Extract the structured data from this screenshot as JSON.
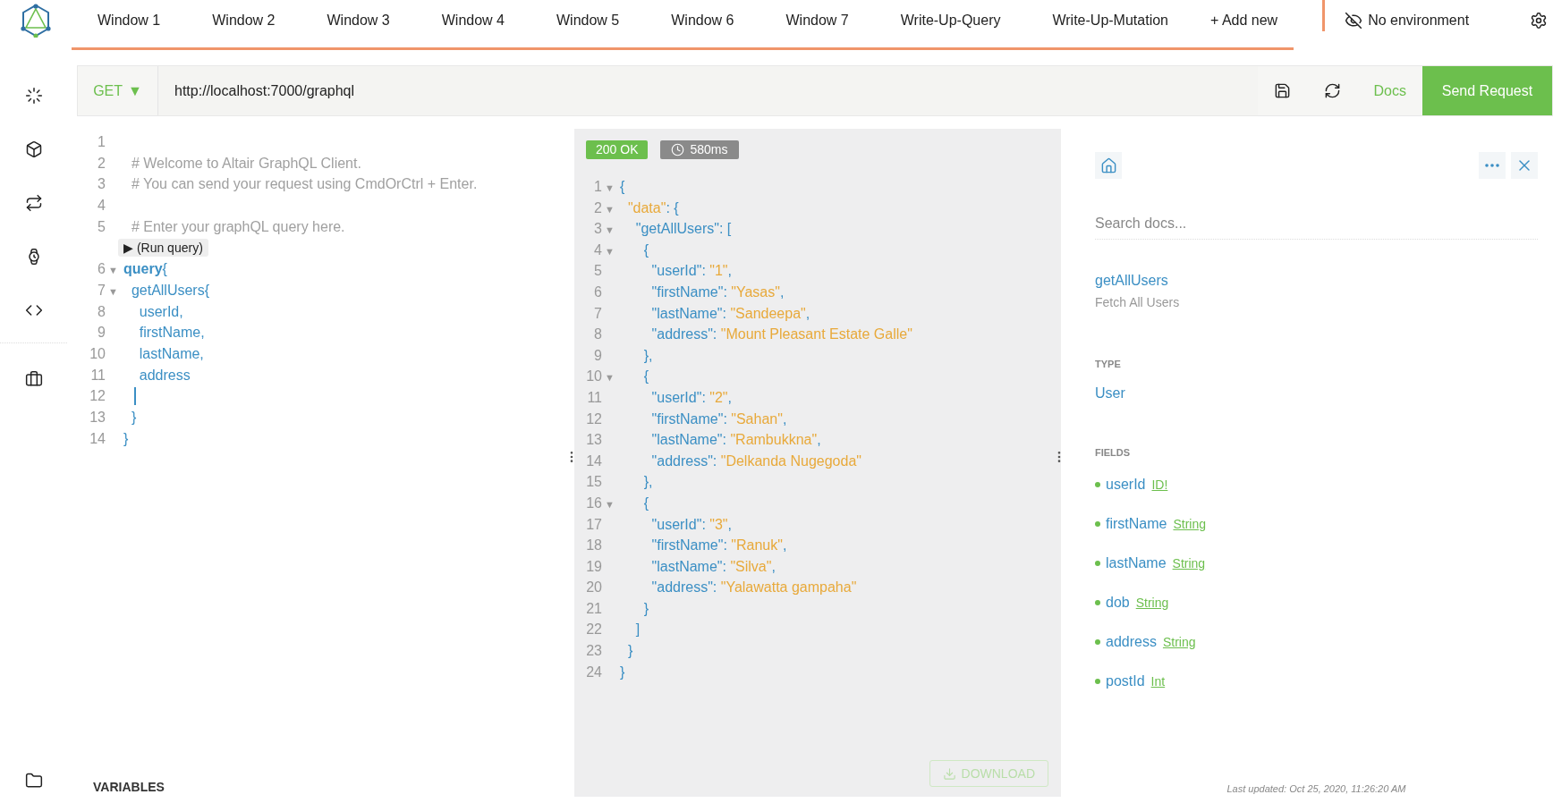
{
  "tabs": [
    {
      "label": "Window 1"
    },
    {
      "label": "Window 2"
    },
    {
      "label": "Window 3"
    },
    {
      "label": "Window 4"
    },
    {
      "label": "Window 5"
    },
    {
      "label": "Window 6"
    },
    {
      "label": "Window 7"
    },
    {
      "label": "Write-Up-Query"
    },
    {
      "label": "Write-Up-Mutation"
    }
  ],
  "add_tab": "+ Add new",
  "environment": "No environment",
  "request": {
    "method": "GET",
    "method_caret": "▼",
    "url": "http://localhost:7000/graphql",
    "docs": "Docs",
    "send": "Send Request"
  },
  "editor": {
    "lines": [
      {
        "kind": "code",
        "num": "1",
        "cursor": false
      },
      {
        "kind": "code",
        "num": "2",
        "cursor": false,
        "tokens": [
          {
            "kind": "comment",
            "text": "  # Welcome to Altair GraphQL Client."
          }
        ]
      },
      {
        "kind": "code",
        "num": "3",
        "cursor": false,
        "tokens": [
          {
            "kind": "comment",
            "text": "  # You can send your request using CmdOrCtrl + Enter."
          }
        ]
      },
      {
        "kind": "code",
        "num": "4",
        "cursor": false
      },
      {
        "kind": "code",
        "num": "5",
        "cursor": false,
        "tokens": [
          {
            "kind": "comment",
            "text": "  # Enter your graphQL query here."
          }
        ]
      },
      {
        "kind": "codelens",
        "text": "▶ (Run query)"
      },
      {
        "kind": "code",
        "num": "6",
        "fold": "▼",
        "cursor": false,
        "tokens": [
          {
            "kind": "keyword",
            "text": "query"
          },
          {
            "kind": "punct",
            "text": "{"
          }
        ]
      },
      {
        "kind": "code",
        "num": "7",
        "fold": "▼",
        "cursor": false,
        "tokens": [
          {
            "kind": "field",
            "text": "  getAllUsers"
          },
          {
            "kind": "punct",
            "text": "{"
          }
        ]
      },
      {
        "kind": "code",
        "num": "8",
        "cursor": false,
        "tokens": [
          {
            "kind": "field",
            "text": "    userId"
          },
          {
            "kind": "punct",
            "text": ","
          }
        ]
      },
      {
        "kind": "code",
        "num": "9",
        "cursor": false,
        "tokens": [
          {
            "kind": "field",
            "text": "    firstName"
          },
          {
            "kind": "punct",
            "text": ","
          }
        ]
      },
      {
        "kind": "code",
        "num": "10",
        "cursor": false,
        "tokens": [
          {
            "kind": "field",
            "text": "    lastName"
          },
          {
            "kind": "punct",
            "text": ","
          }
        ]
      },
      {
        "kind": "code",
        "num": "11",
        "cursor": false,
        "tokens": [
          {
            "kind": "field",
            "text": "    address"
          }
        ]
      },
      {
        "kind": "code",
        "num": "12",
        "cursor": true
      },
      {
        "kind": "code",
        "num": "13",
        "cursor": false,
        "tokens": [
          {
            "kind": "punct",
            "text": "  }"
          }
        ]
      },
      {
        "kind": "code",
        "num": "14",
        "cursor": false,
        "tokens": [
          {
            "kind": "punct",
            "text": "}"
          }
        ]
      }
    ],
    "variables": "VARIABLES"
  },
  "response": {
    "status": "200 OK",
    "time": "580ms",
    "lines": [
      {
        "num": "1",
        "fold": "▼",
        "tokens": [
          {
            "kind": "punct",
            "text": "{"
          }
        ]
      },
      {
        "num": "2",
        "fold": "▼",
        "tokens": [
          {
            "kind": "string",
            "text": "  \"data\""
          },
          {
            "kind": "punct",
            "text": ": {"
          }
        ]
      },
      {
        "num": "3",
        "fold": "▼",
        "tokens": [
          {
            "kind": "key",
            "text": "    \"getAllUsers\""
          },
          {
            "kind": "punct",
            "text": ": ["
          }
        ]
      },
      {
        "num": "4",
        "fold": "▼",
        "tokens": [
          {
            "kind": "punct",
            "text": "      {"
          }
        ]
      },
      {
        "num": "5",
        "tokens": [
          {
            "kind": "key",
            "text": "        \"userId\""
          },
          {
            "kind": "punct",
            "text": ": "
          },
          {
            "kind": "string",
            "text": "\"1\""
          },
          {
            "kind": "punct",
            "text": ","
          }
        ]
      },
      {
        "num": "6",
        "tokens": [
          {
            "kind": "key",
            "text": "        \"firstName\""
          },
          {
            "kind": "punct",
            "text": ": "
          },
          {
            "kind": "string",
            "text": "\"Yasas\""
          },
          {
            "kind": "punct",
            "text": ","
          }
        ]
      },
      {
        "num": "7",
        "tokens": [
          {
            "kind": "key",
            "text": "        \"lastName\""
          },
          {
            "kind": "punct",
            "text": ": "
          },
          {
            "kind": "string",
            "text": "\"Sandeepa\""
          },
          {
            "kind": "punct",
            "text": ","
          }
        ]
      },
      {
        "num": "8",
        "tokens": [
          {
            "kind": "key",
            "text": "        \"address\""
          },
          {
            "kind": "punct",
            "text": ": "
          },
          {
            "kind": "string",
            "text": "\"Mount Pleasant Estate Galle\""
          }
        ]
      },
      {
        "num": "9",
        "tokens": [
          {
            "kind": "punct",
            "text": "      },"
          }
        ]
      },
      {
        "num": "10",
        "fold": "▼",
        "tokens": [
          {
            "kind": "punct",
            "text": "      {"
          }
        ]
      },
      {
        "num": "11",
        "tokens": [
          {
            "kind": "key",
            "text": "        \"userId\""
          },
          {
            "kind": "punct",
            "text": ": "
          },
          {
            "kind": "string",
            "text": "\"2\""
          },
          {
            "kind": "punct",
            "text": ","
          }
        ]
      },
      {
        "num": "12",
        "tokens": [
          {
            "kind": "key",
            "text": "        \"firstName\""
          },
          {
            "kind": "punct",
            "text": ": "
          },
          {
            "kind": "string",
            "text": "\"Sahan\""
          },
          {
            "kind": "punct",
            "text": ","
          }
        ]
      },
      {
        "num": "13",
        "tokens": [
          {
            "kind": "key",
            "text": "        \"lastName\""
          },
          {
            "kind": "punct",
            "text": ": "
          },
          {
            "kind": "string",
            "text": "\"Rambukkna\""
          },
          {
            "kind": "punct",
            "text": ","
          }
        ]
      },
      {
        "num": "14",
        "tokens": [
          {
            "kind": "key",
            "text": "        \"address\""
          },
          {
            "kind": "punct",
            "text": ": "
          },
          {
            "kind": "string",
            "text": "\"Delkanda Nugegoda\""
          }
        ]
      },
      {
        "num": "15",
        "tokens": [
          {
            "kind": "punct",
            "text": "      },"
          }
        ]
      },
      {
        "num": "16",
        "fold": "▼",
        "tokens": [
          {
            "kind": "punct",
            "text": "      {"
          }
        ]
      },
      {
        "num": "17",
        "tokens": [
          {
            "kind": "key",
            "text": "        \"userId\""
          },
          {
            "kind": "punct",
            "text": ": "
          },
          {
            "kind": "string",
            "text": "\"3\""
          },
          {
            "kind": "punct",
            "text": ","
          }
        ]
      },
      {
        "num": "18",
        "tokens": [
          {
            "kind": "key",
            "text": "        \"firstName\""
          },
          {
            "kind": "punct",
            "text": ": "
          },
          {
            "kind": "string",
            "text": "\"Ranuk\""
          },
          {
            "kind": "punct",
            "text": ","
          }
        ]
      },
      {
        "num": "19",
        "tokens": [
          {
            "kind": "key",
            "text": "        \"lastName\""
          },
          {
            "kind": "punct",
            "text": ": "
          },
          {
            "kind": "string",
            "text": "\"Silva\""
          },
          {
            "kind": "punct",
            "text": ","
          }
        ]
      },
      {
        "num": "20",
        "tokens": [
          {
            "kind": "key",
            "text": "        \"address\""
          },
          {
            "kind": "punct",
            "text": ": "
          },
          {
            "kind": "string",
            "text": "\"Yalawatta gampaha\""
          }
        ]
      },
      {
        "num": "21",
        "tokens": [
          {
            "kind": "punct",
            "text": "      }"
          }
        ]
      },
      {
        "num": "22",
        "tokens": [
          {
            "kind": "punct",
            "text": "    ]"
          }
        ]
      },
      {
        "num": "23",
        "tokens": [
          {
            "kind": "punct",
            "text": "  }"
          }
        ]
      },
      {
        "num": "24",
        "tokens": [
          {
            "kind": "punct",
            "text": "}"
          }
        ]
      }
    ],
    "download": {
      "label": "DOWNLOAD",
      "disabled": true
    }
  },
  "docs": {
    "search": {
      "placeholder": "Search docs..."
    },
    "title": "getAllUsers",
    "description": "Fetch All Users",
    "type_heading": "TYPE",
    "type": "User",
    "fields_heading": "FIELDS",
    "fields": [
      {
        "name": "userId",
        "type": "ID!"
      },
      {
        "name": "firstName",
        "type": "String"
      },
      {
        "name": "lastName",
        "type": "String"
      },
      {
        "name": "dob",
        "type": "String"
      },
      {
        "name": "address",
        "type": "String"
      },
      {
        "name": "postId",
        "type": "Int"
      }
    ],
    "last_updated": "Last updated: Oct 25, 2020, 11:26:20 AM"
  }
}
